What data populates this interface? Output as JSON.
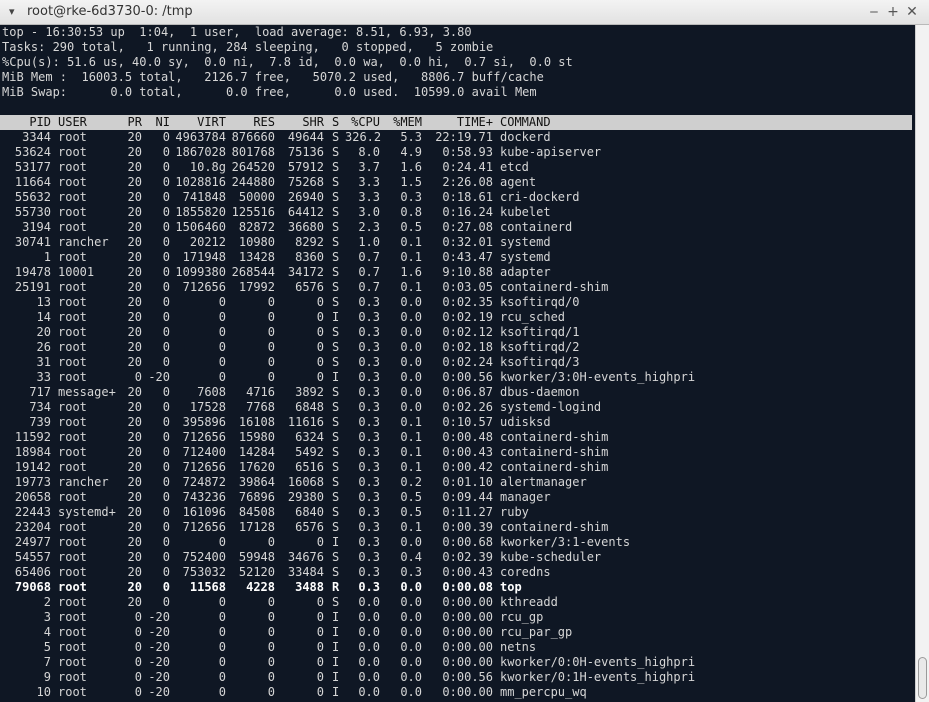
{
  "window": {
    "title": "root@rke-6d3730-0: /tmp",
    "arrow": "▾",
    "buttons": {
      "minimize": "‒",
      "maximize": "+",
      "close": "✕"
    }
  },
  "summary": [
    "top - 16:30:53 up  1:04,  1 user,  load average: 8.51, 6.93, 3.80",
    "Tasks: 290 total,   1 running, 284 sleeping,   0 stopped,   5 zombie",
    "%Cpu(s): 51.6 us, 40.0 sy,  0.0 ni,  7.8 id,  0.0 wa,  0.0 hi,  0.7 si,  0.0 st",
    "MiB Mem :  16003.5 total,   2126.7 free,   5070.2 used,   8806.7 buff/cache",
    "MiB Swap:      0.0 total,      0.0 free,      0.0 used.  10599.0 avail Mem"
  ],
  "columns": [
    "PID",
    "USER",
    "PR",
    "NI",
    "VIRT",
    "RES",
    "SHR",
    "S",
    "%CPU",
    "%MEM",
    "TIME+",
    "COMMAND"
  ],
  "processes": [
    [
      "3344",
      "root",
      "20",
      "0",
      "4963784",
      "876660",
      "49644",
      "S",
      "326.2",
      "5.3",
      "22:19.71",
      "dockerd"
    ],
    [
      "53624",
      "root",
      "20",
      "0",
      "1867028",
      "801768",
      "75136",
      "S",
      "8.0",
      "4.9",
      "0:58.93",
      "kube-apiserver"
    ],
    [
      "53177",
      "root",
      "20",
      "0",
      "10.8g",
      "264520",
      "57912",
      "S",
      "3.7",
      "1.6",
      "0:24.41",
      "etcd"
    ],
    [
      "11664",
      "root",
      "20",
      "0",
      "1028816",
      "244880",
      "75268",
      "S",
      "3.3",
      "1.5",
      "2:26.08",
      "agent"
    ],
    [
      "55632",
      "root",
      "20",
      "0",
      "741848",
      "50000",
      "26940",
      "S",
      "3.3",
      "0.3",
      "0:18.61",
      "cri-dockerd"
    ],
    [
      "55730",
      "root",
      "20",
      "0",
      "1855820",
      "125516",
      "64412",
      "S",
      "3.0",
      "0.8",
      "0:16.24",
      "kubelet"
    ],
    [
      "3194",
      "root",
      "20",
      "0",
      "1506460",
      "82872",
      "36680",
      "S",
      "2.3",
      "0.5",
      "0:27.08",
      "containerd"
    ],
    [
      "30741",
      "rancher",
      "20",
      "0",
      "20212",
      "10980",
      "8292",
      "S",
      "1.0",
      "0.1",
      "0:32.01",
      "systemd"
    ],
    [
      "1",
      "root",
      "20",
      "0",
      "171948",
      "13428",
      "8360",
      "S",
      "0.7",
      "0.1",
      "0:43.47",
      "systemd"
    ],
    [
      "19478",
      "10001",
      "20",
      "0",
      "1099380",
      "268544",
      "34172",
      "S",
      "0.7",
      "1.6",
      "9:10.88",
      "adapter"
    ],
    [
      "25191",
      "root",
      "20",
      "0",
      "712656",
      "17992",
      "6576",
      "S",
      "0.7",
      "0.1",
      "0:03.05",
      "containerd-shim"
    ],
    [
      "13",
      "root",
      "20",
      "0",
      "0",
      "0",
      "0",
      "S",
      "0.3",
      "0.0",
      "0:02.35",
      "ksoftirqd/0"
    ],
    [
      "14",
      "root",
      "20",
      "0",
      "0",
      "0",
      "0",
      "I",
      "0.3",
      "0.0",
      "0:02.19",
      "rcu_sched"
    ],
    [
      "20",
      "root",
      "20",
      "0",
      "0",
      "0",
      "0",
      "S",
      "0.3",
      "0.0",
      "0:02.12",
      "ksoftirqd/1"
    ],
    [
      "26",
      "root",
      "20",
      "0",
      "0",
      "0",
      "0",
      "S",
      "0.3",
      "0.0",
      "0:02.18",
      "ksoftirqd/2"
    ],
    [
      "31",
      "root",
      "20",
      "0",
      "0",
      "0",
      "0",
      "S",
      "0.3",
      "0.0",
      "0:02.24",
      "ksoftirqd/3"
    ],
    [
      "33",
      "root",
      "0",
      "-20",
      "0",
      "0",
      "0",
      "I",
      "0.3",
      "0.0",
      "0:00.56",
      "kworker/3:0H-events_highpri"
    ],
    [
      "717",
      "message+",
      "20",
      "0",
      "7608",
      "4716",
      "3892",
      "S",
      "0.3",
      "0.0",
      "0:06.87",
      "dbus-daemon"
    ],
    [
      "734",
      "root",
      "20",
      "0",
      "17528",
      "7768",
      "6848",
      "S",
      "0.3",
      "0.0",
      "0:02.26",
      "systemd-logind"
    ],
    [
      "739",
      "root",
      "20",
      "0",
      "395896",
      "16108",
      "11616",
      "S",
      "0.3",
      "0.1",
      "0:10.57",
      "udisksd"
    ],
    [
      "11592",
      "root",
      "20",
      "0",
      "712656",
      "15980",
      "6324",
      "S",
      "0.3",
      "0.1",
      "0:00.48",
      "containerd-shim"
    ],
    [
      "18984",
      "root",
      "20",
      "0",
      "712400",
      "14284",
      "5492",
      "S",
      "0.3",
      "0.1",
      "0:00.43",
      "containerd-shim"
    ],
    [
      "19142",
      "root",
      "20",
      "0",
      "712656",
      "17620",
      "6516",
      "S",
      "0.3",
      "0.1",
      "0:00.42",
      "containerd-shim"
    ],
    [
      "19773",
      "rancher",
      "20",
      "0",
      "724872",
      "39864",
      "16068",
      "S",
      "0.3",
      "0.2",
      "0:01.10",
      "alertmanager"
    ],
    [
      "20658",
      "root",
      "20",
      "0",
      "743236",
      "76896",
      "29380",
      "S",
      "0.3",
      "0.5",
      "0:09.44",
      "manager"
    ],
    [
      "22443",
      "systemd+",
      "20",
      "0",
      "161096",
      "84508",
      "6840",
      "S",
      "0.3",
      "0.5",
      "0:11.27",
      "ruby"
    ],
    [
      "23204",
      "root",
      "20",
      "0",
      "712656",
      "17128",
      "6576",
      "S",
      "0.3",
      "0.1",
      "0:00.39",
      "containerd-shim"
    ],
    [
      "24977",
      "root",
      "20",
      "0",
      "0",
      "0",
      "0",
      "I",
      "0.3",
      "0.0",
      "0:00.68",
      "kworker/3:1-events"
    ],
    [
      "54557",
      "root",
      "20",
      "0",
      "752400",
      "59948",
      "34676",
      "S",
      "0.3",
      "0.4",
      "0:02.39",
      "kube-scheduler"
    ],
    [
      "65406",
      "root",
      "20",
      "0",
      "753032",
      "52120",
      "33484",
      "S",
      "0.3",
      "0.3",
      "0:00.43",
      "coredns"
    ],
    [
      "79068",
      "root",
      "20",
      "0",
      "11568",
      "4228",
      "3488",
      "R",
      "0.3",
      "0.0",
      "0:00.08",
      "top"
    ],
    [
      "2",
      "root",
      "20",
      "0",
      "0",
      "0",
      "0",
      "S",
      "0.0",
      "0.0",
      "0:00.00",
      "kthreadd"
    ],
    [
      "3",
      "root",
      "0",
      "-20",
      "0",
      "0",
      "0",
      "I",
      "0.0",
      "0.0",
      "0:00.00",
      "rcu_gp"
    ],
    [
      "4",
      "root",
      "0",
      "-20",
      "0",
      "0",
      "0",
      "I",
      "0.0",
      "0.0",
      "0:00.00",
      "rcu_par_gp"
    ],
    [
      "5",
      "root",
      "0",
      "-20",
      "0",
      "0",
      "0",
      "I",
      "0.0",
      "0.0",
      "0:00.00",
      "netns"
    ],
    [
      "7",
      "root",
      "0",
      "-20",
      "0",
      "0",
      "0",
      "I",
      "0.0",
      "0.0",
      "0:00.00",
      "kworker/0:0H-events_highpri"
    ],
    [
      "9",
      "root",
      "0",
      "-20",
      "0",
      "0",
      "0",
      "I",
      "0.0",
      "0.0",
      "0:00.56",
      "kworker/0:1H-events_highpri"
    ],
    [
      "10",
      "root",
      "0",
      "-20",
      "0",
      "0",
      "0",
      "I",
      "0.0",
      "0.0",
      "0:00.00",
      "mm_percpu_wq"
    ]
  ],
  "highlight_pid": "79068"
}
